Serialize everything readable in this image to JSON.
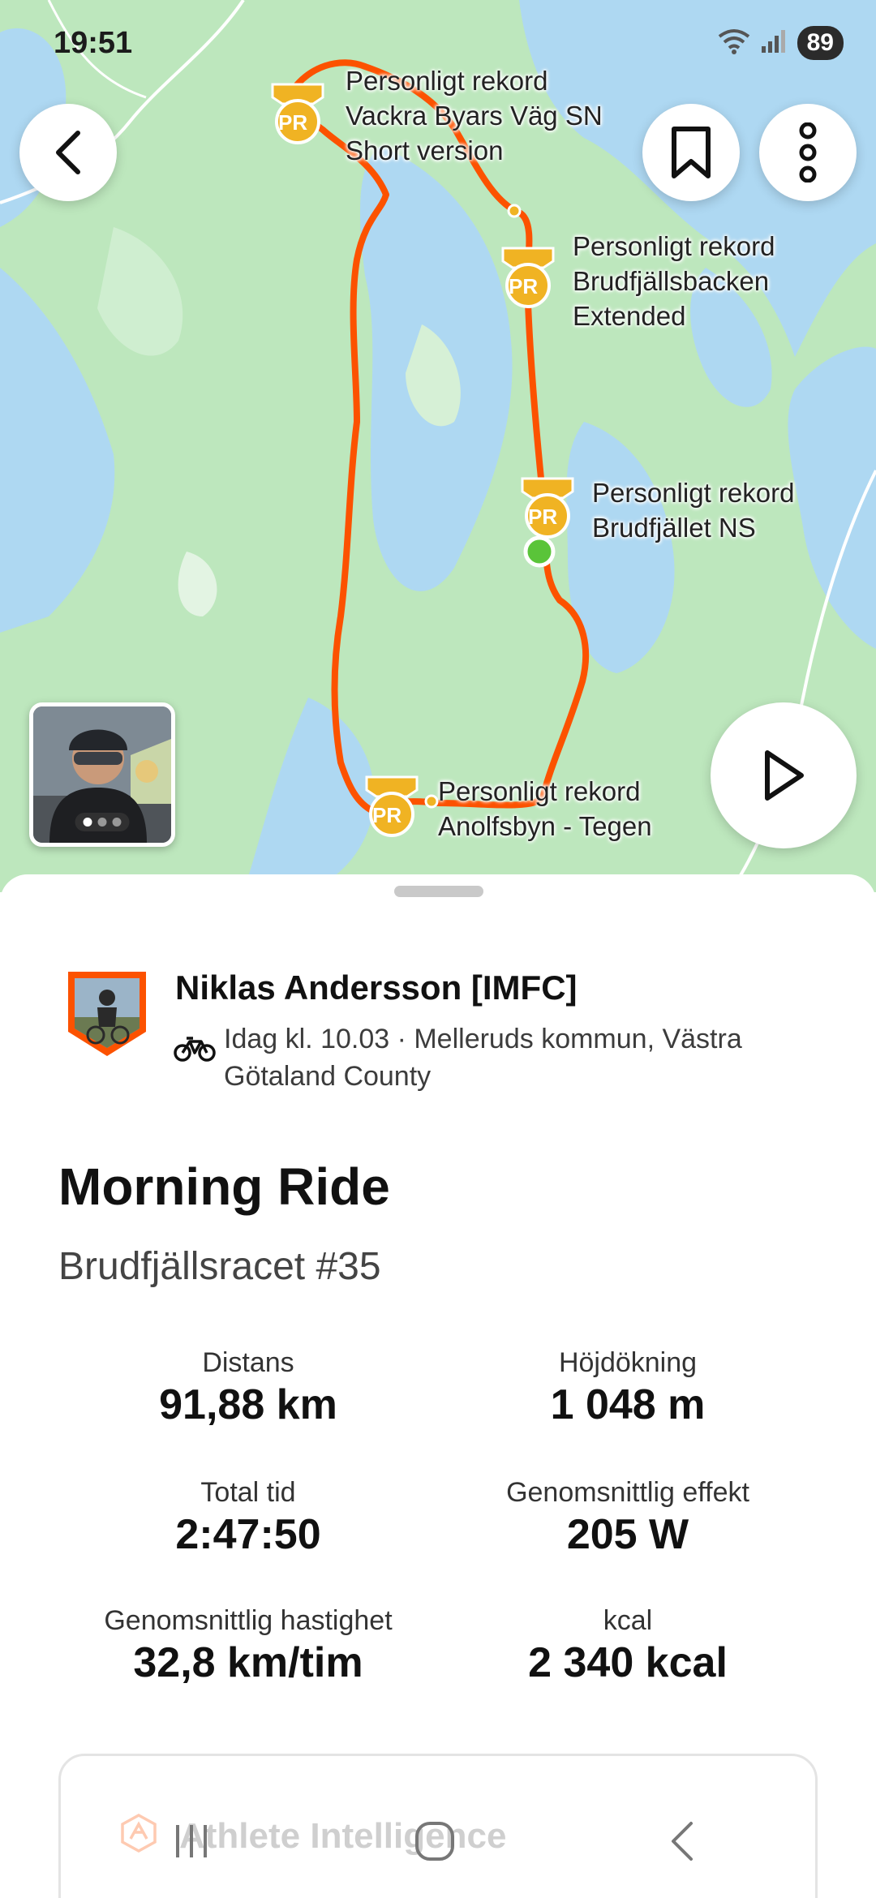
{
  "status_bar": {
    "time": "19:51",
    "battery": "89",
    "icons": [
      "wifi-icon",
      "signal-icon"
    ]
  },
  "map": {
    "pr_badge_text": "PR",
    "segments": [
      {
        "title": "Personligt rekord",
        "name_lines": [
          "Vackra Byars Väg SN",
          "Short version"
        ]
      },
      {
        "title": "Personligt rekord",
        "name_lines": [
          "Brudfjällsbacken",
          "Extended"
        ]
      },
      {
        "title": "Personligt rekord",
        "name_lines": [
          "Brudfjället NS"
        ]
      },
      {
        "title": "Personligt rekord",
        "name_lines": [
          "Anolfsbyn - Tegen"
        ]
      }
    ],
    "photo_count": 3,
    "photo_active_index": 0,
    "colors": {
      "water": "#aed8f2",
      "land": "#bde7bd",
      "route": "#fc5200",
      "pr_gold": "#f0b323",
      "start_dot": "#5ac439"
    }
  },
  "toolbar": {
    "back_icon": "chevron-left-icon",
    "bookmark_icon": "bookmark-icon",
    "more_icon": "more-vertical-icon",
    "play_icon": "play-icon"
  },
  "athlete": {
    "name": "Niklas Andersson [IMFC]",
    "meta": "Idag kl. 10.03 · Melleruds kommun, Västra Götaland County",
    "sport_icon": "bike-icon"
  },
  "activity": {
    "title": "Morning Ride",
    "description": "Brudfjällsracet #35"
  },
  "stats": [
    {
      "label": "Distans",
      "value": "91,88 km"
    },
    {
      "label": "Höjdökning",
      "value": "1 048 m"
    },
    {
      "label": "Total tid",
      "value": "2:47:50"
    },
    {
      "label": "Genomsnittlig effekt",
      "value": "205 W"
    },
    {
      "label": "Genomsnittlig hastighet",
      "value": "32,8 km/tim"
    },
    {
      "label": "kcal",
      "value": "2 340 kcal"
    }
  ],
  "athlete_intelligence": {
    "label": "Athlete Intelligence"
  },
  "nav_bar": {
    "recents_icon": "recents-icon",
    "home_icon": "home-icon",
    "back_icon": "back-icon"
  }
}
